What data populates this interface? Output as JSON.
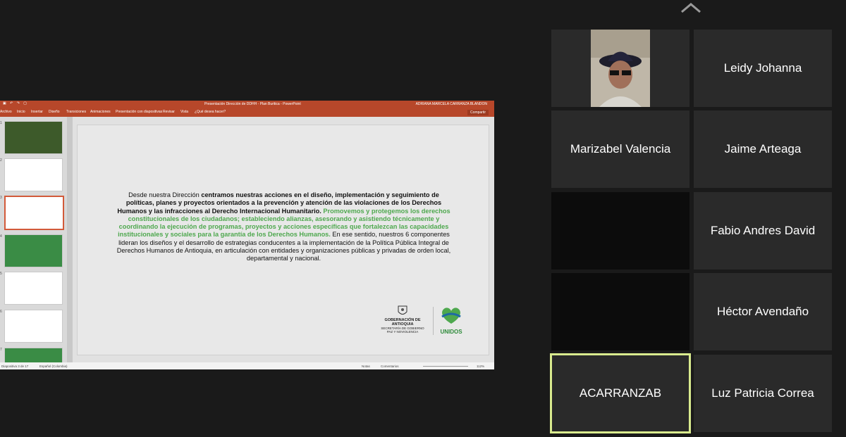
{
  "collapse_icon": "chevron-up-icon",
  "participants": [
    {
      "name": "",
      "has_video": true
    },
    {
      "name": "Leidy Johanna"
    },
    {
      "name": "Marizabel Valencia"
    },
    {
      "name": "Jaime Arteaga"
    },
    {
      "name": "",
      "dark": true
    },
    {
      "name": "Fabio Andres David"
    },
    {
      "name": "",
      "dark": true
    },
    {
      "name": "Héctor Avendaño"
    },
    {
      "name": "ACARRANZAB",
      "active_speaker": true
    },
    {
      "name": "Luz Patricia Correa"
    }
  ],
  "ppt": {
    "window_title": "Presentación Dirección de DDHH - Plan Buritica - PowerPoint",
    "user": "ADRIANA MARCELA CARRANZA BLANDON",
    "menu": [
      "Archivo",
      "Inicio",
      "Insertar",
      "Diseño",
      "Transiciones",
      "Animaciones",
      "Presentación con diapositivas",
      "Revisar",
      "Vista",
      "¿Qué desea hacer?"
    ],
    "share_label": "Compartir",
    "slide_numbers": [
      "1",
      "2",
      "3",
      "4",
      "5",
      "6",
      "7"
    ],
    "slide": {
      "p1": "Desde nuestra Dirección ",
      "p2": "centramos nuestras acciones en el diseño, implementación y seguimiento de políticas, planes y proyectos orientados a la prevención y atención de las violaciones de los Derechos Humanos y las infracciones al Derecho Internacional Humanitario.",
      "p3": " Promovemos y protegemos los derechos constitucionales de los ciudadanos; estableciendo alianzas, asesorando y asistiendo técnicamente y coordinando la ejecución de programas, proyectos y acciones específicas que fortalezcan las capacidades institucionales y sociales para la garantía de los Derechos Humanos.",
      "p4": " En ese sentido, nuestros 6 componentes lideran los diseños y el desarrollo de estrategias conducentes a la implementación de la Política Pública Integral de Derechos Humanos de Antioquia, en articulación con entidades y organizaciones públicas y privadas de orden local, departamental y nacional.",
      "logo_gob_1": "GOBERNACIÓN DE ANTIOQUIA",
      "logo_gob_2": "SECRETARÍA DE GOBIERNO",
      "logo_gob_3": "PAZ Y NOVIOLENCIA",
      "logo_unidos": "UNIDOS"
    },
    "status": {
      "slide_count": "Diapositiva 3 de 17",
      "language": "Español (Colombia)",
      "notes": "Notas",
      "comments": "Comentarios",
      "zoom": "112%"
    },
    "accent": "#b7472a"
  }
}
